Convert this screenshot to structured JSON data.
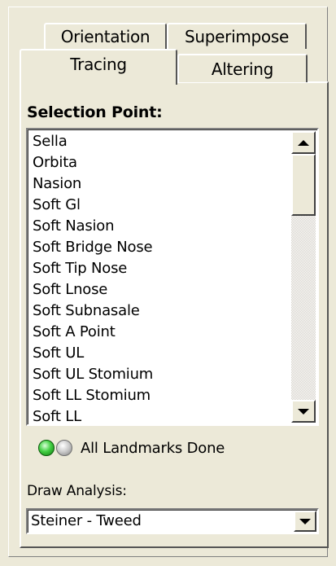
{
  "tabs": {
    "orientation": "Orientation",
    "superimpose": "Superimpose",
    "tracing": "Tracing",
    "altering": "Altering",
    "active": "Tracing"
  },
  "selection": {
    "label": "Selection Point:",
    "items": [
      "Sella",
      "Orbita",
      "Nasion",
      "Soft Gl",
      "Soft Nasion",
      "Soft Bridge Nose",
      "Soft Tip Nose",
      "Soft Lnose",
      "Soft Subnasale",
      "Soft A Point",
      "Soft UL",
      "Soft UL Stomium",
      "Soft LL Stomium",
      "Soft LL"
    ]
  },
  "status": {
    "text": "All Landmarks Done",
    "indicators": [
      {
        "name": "green-led-icon",
        "color": "#3ccf3c"
      },
      {
        "name": "gray-led-icon",
        "color": "#b0b0b0"
      }
    ]
  },
  "draw_analysis": {
    "label": "Draw Analysis:",
    "selected": "Steiner - Tweed"
  },
  "icons": {
    "scroll_up": "arrow-up-icon",
    "scroll_down": "arrow-down-icon",
    "dropdown": "chevron-down-icon"
  }
}
